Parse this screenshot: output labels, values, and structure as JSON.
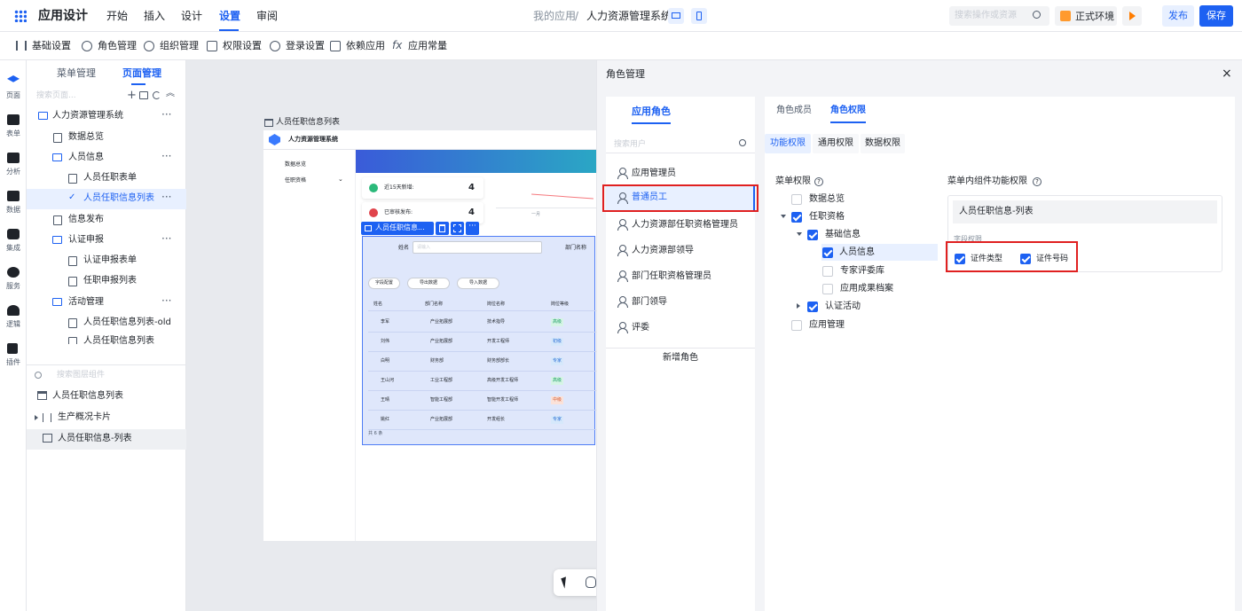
{
  "header": {
    "app_title": "应用设计",
    "tabs": [
      "开始",
      "插入",
      "设计",
      "设置",
      "审阅"
    ],
    "active_tab": "设置",
    "breadcrumb": [
      "我的应用",
      "/",
      "人力资源管理系统"
    ],
    "search_placeholder": "搜索操作或资源",
    "env_label": "正式环境",
    "publish_label": "发布",
    "save_label": "保存"
  },
  "toolbar": {
    "items": [
      "基础设置",
      "角色管理",
      "组织管理",
      "权限设置",
      "登录设置",
      "依赖应用",
      "应用常量"
    ]
  },
  "left_rail": {
    "items": [
      "页面",
      "表单",
      "分析",
      "数据",
      "集成",
      "服务",
      "逻辑",
      "插件"
    ]
  },
  "nav_panel": {
    "tabs": [
      "菜单管理",
      "页面管理"
    ],
    "active_tab": "页面管理",
    "search_placeholder": "搜索页面...",
    "tree": [
      {
        "label": "人力资源管理系统",
        "type": "folder",
        "level": 0
      },
      {
        "label": "数据总览",
        "type": "page",
        "level": 1
      },
      {
        "label": "人员信息",
        "type": "folder",
        "level": 1
      },
      {
        "label": "人员任职表单",
        "type": "page",
        "level": 2
      },
      {
        "label": "人员任职信息列表",
        "type": "page",
        "level": 2,
        "selected": true
      },
      {
        "label": "信息发布",
        "type": "page",
        "level": 1
      },
      {
        "label": "认证申报",
        "type": "folder",
        "level": 1
      },
      {
        "label": "认证申报表单",
        "type": "page",
        "level": 2
      },
      {
        "label": "任职申报列表",
        "type": "page",
        "level": 2
      },
      {
        "label": "活动管理",
        "type": "folder",
        "level": 1
      },
      {
        "label": "人员任职信息列表-old",
        "type": "page",
        "level": 2
      },
      {
        "label": "人员任职信息列表",
        "type": "page",
        "level": 2
      }
    ],
    "component_search_placeholder": "搜索图层组件",
    "layers": [
      "人员任职信息列表",
      "生产概况卡片",
      "人员任职信息-列表"
    ]
  },
  "canvas": {
    "frame_title": "人员任职信息列表",
    "preview_app_title": "人力资源管理系统",
    "preview_sidebar": [
      "数据总览",
      "任职资格"
    ],
    "stat1_label": "近15天新增:",
    "stat1_value": "4",
    "stat2_label": "已审核发布:",
    "stat2_value": "4",
    "chart_xlabel": "一月",
    "selected_component_label": "人员任职信息...",
    "filter_label": "姓名",
    "filter_placeholder": "请输入",
    "filter_label2": "部门名称",
    "buttons": [
      "字段配置",
      "导出数据",
      "导入数据"
    ],
    "table_headers": [
      "姓名",
      "部门名称",
      "岗位名称",
      "岗位等级"
    ],
    "table_rows": [
      [
        "李军",
        "产业拓展部",
        "技术指导",
        "高级"
      ],
      [
        "刘伟",
        "产业拓展部",
        "开发工程师",
        "初级"
      ],
      [
        "白明",
        "财务部",
        "财务部部长",
        "专家"
      ],
      [
        "王山河",
        "工业工程部",
        "高级开发工程师",
        "高级"
      ],
      [
        "王晴",
        "智能工程部",
        "智能开发工程师",
        "中级"
      ],
      [
        "姚红",
        "产业拓展部",
        "开发组长",
        "专家"
      ]
    ],
    "total_label": "共 6 条"
  },
  "modal": {
    "title": "角色管理",
    "left_tab": "应用角色",
    "search_placeholder": "搜索用户",
    "roles": [
      "应用管理员",
      "普通员工",
      "人力资源部任职资格管理员",
      "人力资源部领导",
      "部门任职资格管理员",
      "部门领导",
      "评委"
    ],
    "selected_role": "普通员工",
    "add_role_label": "新增角色",
    "right_tabs": [
      "角色成员",
      "角色权限"
    ],
    "active_right_tab": "角色权限",
    "sub_tabs": [
      "功能权限",
      "通用权限",
      "数据权限"
    ],
    "active_sub_tab": "功能权限",
    "menu_perm_title": "菜单权限",
    "menu_tree": [
      {
        "label": "数据总览",
        "checked": false,
        "level": 1
      },
      {
        "label": "任职资格",
        "checked": true,
        "level": 0
      },
      {
        "label": "基础信息",
        "checked": true,
        "level": 1
      },
      {
        "label": "人员信息",
        "checked": true,
        "level": 2,
        "highlight": true
      },
      {
        "label": "专家评委库",
        "checked": false,
        "level": 2
      },
      {
        "label": "应用成果档案",
        "checked": false,
        "level": 2
      },
      {
        "label": "认证活动",
        "checked": true,
        "level": 1
      },
      {
        "label": "应用管理",
        "checked": false,
        "level": 0
      }
    ],
    "component_perm_title": "菜单内组件功能权限",
    "component_name": "人员任职信息-列表",
    "field_perm_label": "字段权限",
    "field_perms": [
      {
        "label": "证件类型",
        "checked": true
      },
      {
        "label": "证件号码",
        "checked": true
      }
    ]
  },
  "colors": {
    "accent": "#1d61f2",
    "highlight_box": "#e02020",
    "selected_bg": "#e8f0ff"
  }
}
